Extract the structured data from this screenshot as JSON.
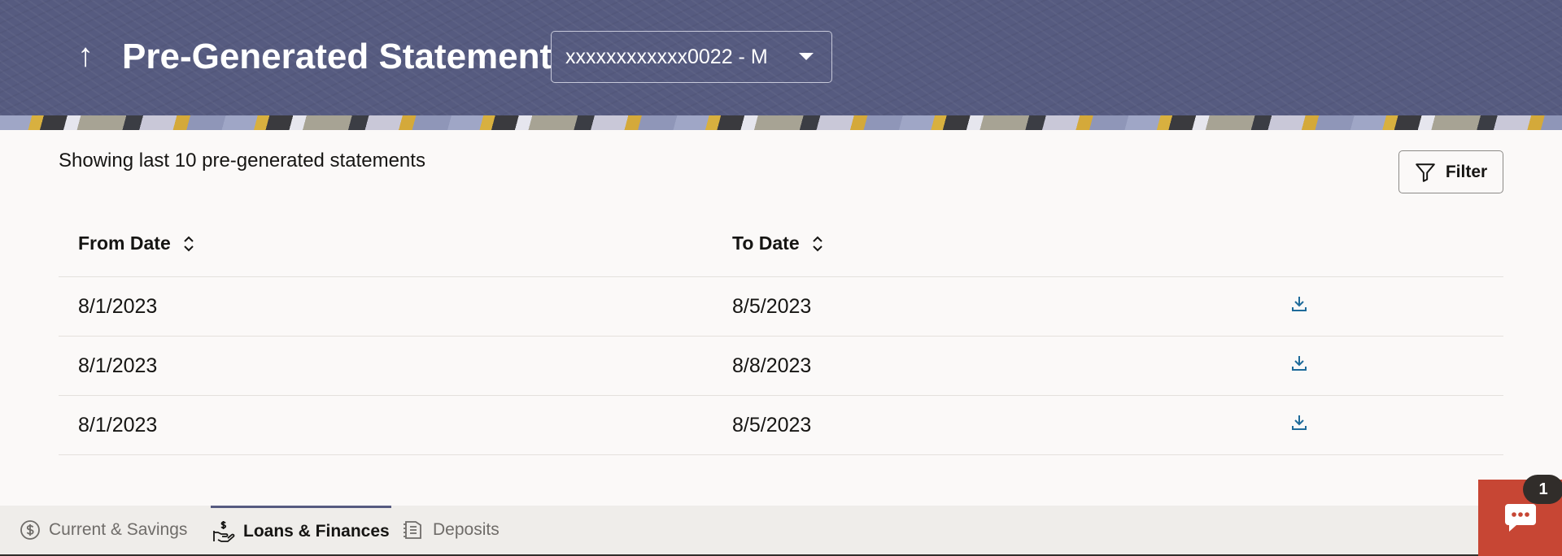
{
  "header": {
    "title": "Pre-Generated Statement",
    "account": "xxxxxxxxxxxx0022 - M"
  },
  "summary_text": "Showing last 10 pre-generated statements",
  "filter_label": "Filter",
  "table": {
    "columns": [
      "From Date",
      "To Date"
    ],
    "rows": [
      {
        "from": "8/1/2023",
        "to": "8/5/2023"
      },
      {
        "from": "8/1/2023",
        "to": "8/8/2023"
      },
      {
        "from": "8/1/2023",
        "to": "8/5/2023"
      }
    ]
  },
  "tabs": [
    {
      "label": "Current & Savings",
      "icon": "dollar-circle-icon",
      "active": false
    },
    {
      "label": "Loans & Finances",
      "icon": "hand-money-icon",
      "active": true
    },
    {
      "label": "Deposits",
      "icon": "ledger-icon",
      "active": false
    }
  ],
  "chat": {
    "badge": "1"
  },
  "colors": {
    "header": "#565b80",
    "link": "#1f6b9a",
    "chat": "#c74634"
  }
}
